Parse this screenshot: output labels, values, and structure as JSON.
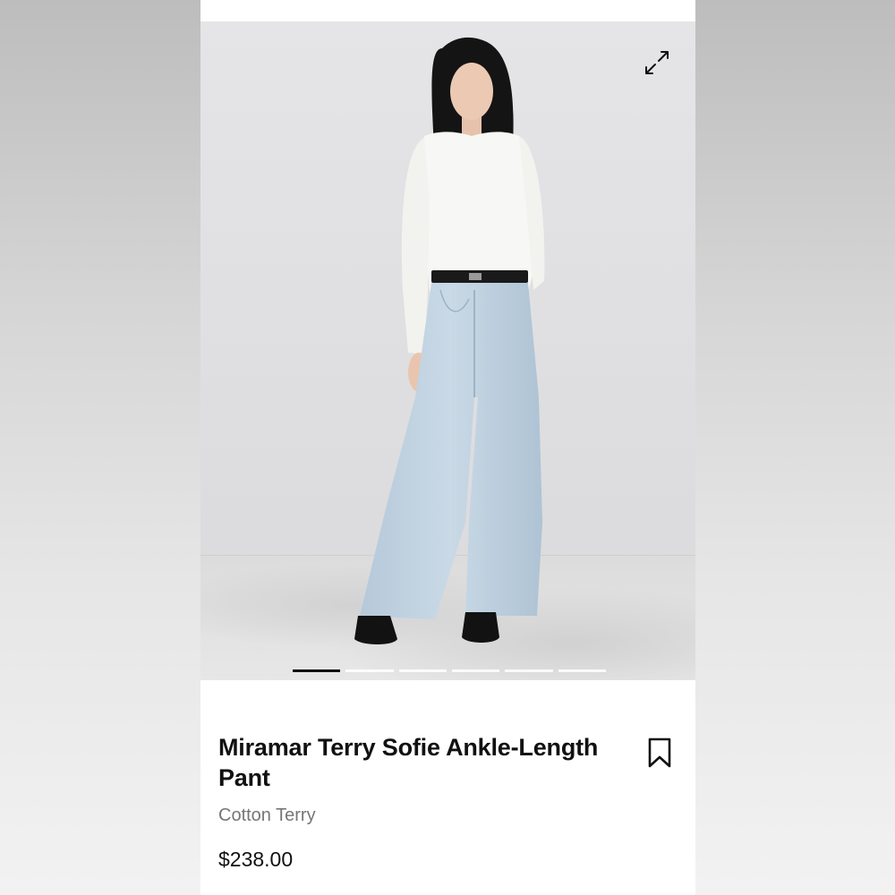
{
  "product": {
    "name": "Miramar Terry Sofie Ankle-Length Pant",
    "fabric": "Cotton Terry",
    "price": "$238.00"
  },
  "gallery": {
    "image_count": 6,
    "active_index": 0,
    "icons": {
      "expand": "expand-arrows-icon",
      "save": "bookmark-icon"
    }
  },
  "colors": {
    "text_primary": "#111111",
    "text_secondary": "#767676",
    "background": "#ffffff",
    "pager_active": "#111111",
    "pager_inactive": "#ffffff"
  }
}
